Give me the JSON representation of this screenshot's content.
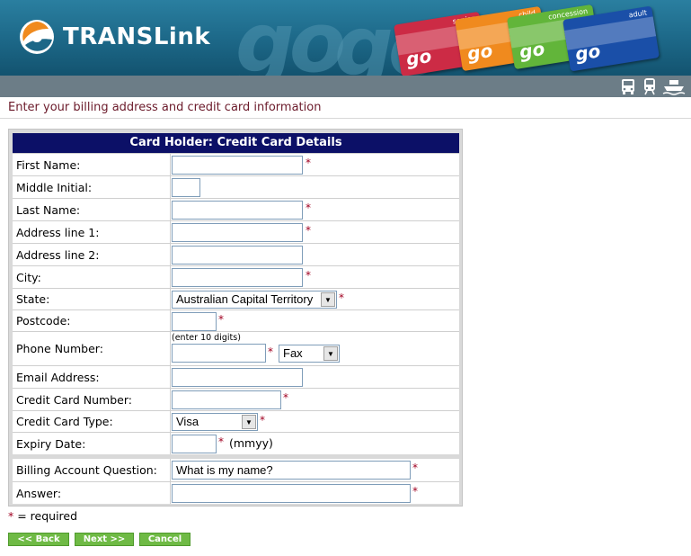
{
  "header": {
    "brand": "TRANSLink",
    "ghost_text": "go",
    "cards": [
      {
        "label": "senior",
        "go": "go",
        "color": "#cc2b45"
      },
      {
        "label": "child",
        "go": "go",
        "color": "#f08a1e"
      },
      {
        "label": "concession",
        "go": "go",
        "color": "#62b53a"
      },
      {
        "label": "adult",
        "go": "go",
        "color": "#1a4fa8"
      }
    ]
  },
  "intro_text": "Enter your billing address and credit card information",
  "form": {
    "title": "Card Holder: Credit Card Details",
    "labels": {
      "first_name": "First Name:",
      "middle_initial": "Middle Initial:",
      "last_name": "Last Name:",
      "address1": "Address line 1:",
      "address2": "Address line 2:",
      "city": "City:",
      "state": "State:",
      "postcode": "Postcode:",
      "phone": "Phone Number:",
      "email": "Email Address:",
      "cc_number": "Credit Card Number:",
      "cc_type": "Credit Card Type:",
      "expiry": "Expiry Date:",
      "billing_question": "Billing Account Question:",
      "answer": "Answer:"
    },
    "values": {
      "first_name": "",
      "middle_initial": "",
      "last_name": "",
      "address1": "",
      "address2": "",
      "city": "",
      "postcode": "",
      "phone": "",
      "email": "",
      "cc_number": "",
      "expiry": "",
      "billing_question": "What is my name?",
      "answer": ""
    },
    "state_selected": "Australian Capital Territory",
    "phone_hint": "(enter 10 digits)",
    "phone_type_selected": "Fax",
    "cc_type_selected": "Visa",
    "expiry_hint": "(mmyy)",
    "required_marker": "*"
  },
  "required_note": {
    "star": "*",
    "text": " = required"
  },
  "buttons": {
    "back": "<< Back",
    "next": "Next >>",
    "cancel": "Cancel"
  },
  "colors": {
    "header_bg": "#1c6787",
    "form_title_bg": "#0c1067",
    "required": "#a00020",
    "intro_text": "#6b1a2a",
    "button_bg": "#6fba45"
  }
}
